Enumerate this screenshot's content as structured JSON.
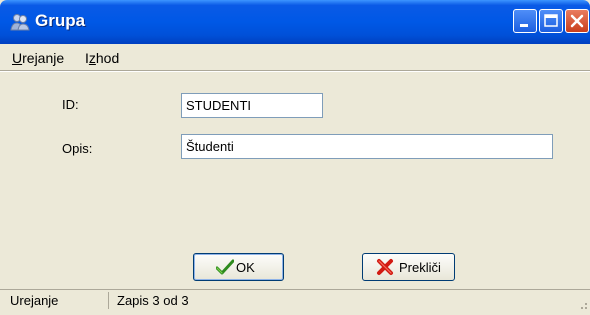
{
  "window": {
    "title": "Grupa",
    "controls": {
      "minimize": "minimize",
      "maximize": "maximize",
      "close": "close"
    }
  },
  "menu": {
    "items": [
      {
        "label": "Urejanje",
        "mnemonic": "U"
      },
      {
        "label": "Izhod",
        "mnemonic": "z"
      }
    ]
  },
  "form": {
    "id_label": "ID:",
    "id_value": "STUDENTI",
    "opis_label": "Opis:",
    "opis_value": "Študenti"
  },
  "buttons": {
    "ok_label": "OK",
    "cancel_label": "Prekliči"
  },
  "status": {
    "mode": "Urejanje",
    "record": "Zapis 3 od 3"
  },
  "colors": {
    "titlebar": "#0058e6",
    "background": "#ece9d8",
    "field_border": "#7f9db9",
    "close_button": "#c93f1c"
  },
  "icons": {
    "title": "group-icon",
    "ok": "checkmark-icon",
    "cancel": "red-x-icon"
  }
}
